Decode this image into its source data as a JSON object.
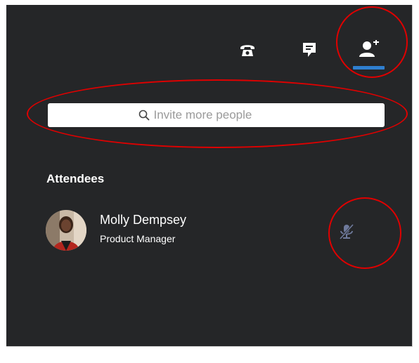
{
  "toolbar": {
    "phone_icon": "phone-icon",
    "chat_icon": "chat-icon",
    "add_person_icon": "add-person-icon",
    "active_tab_color": "#2f7fd0"
  },
  "search": {
    "placeholder": "Invite more people",
    "value": ""
  },
  "attendees": {
    "title": "Attendees",
    "items": [
      {
        "name": "Molly Dempsey",
        "role": "Product Manager",
        "mic_icon": "mic-muted-icon"
      }
    ]
  },
  "annotations": {
    "color": "#e00000"
  },
  "colors": {
    "panel_bg": "#252628"
  }
}
